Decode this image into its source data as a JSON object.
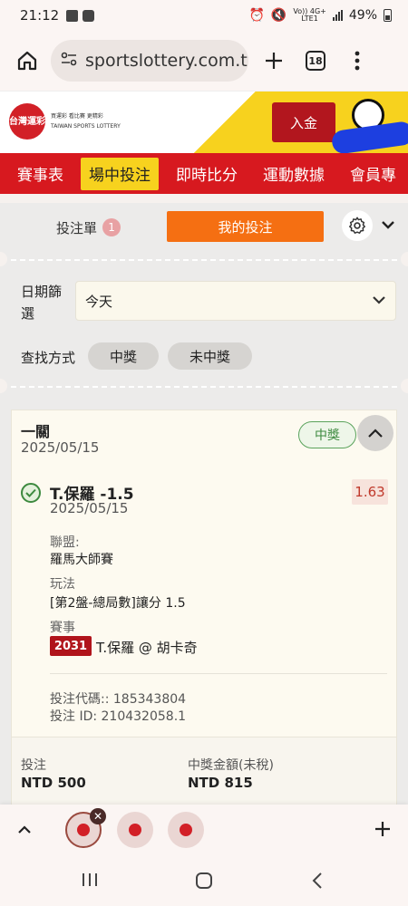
{
  "status_bar": {
    "time": "21:12",
    "network_top": "Vo)) 4G+",
    "network_bottom": "LTE1",
    "battery": "49%"
  },
  "browser": {
    "url": "sportslottery.com.tw",
    "tab_count": "18"
  },
  "site": {
    "logo_text": "台灣運彩",
    "logo_sub_line1": "買運彩  看比賽  更精彩",
    "logo_sub_line2": "TAIWAN SPORTS LOTTERY",
    "deposit_label": "入金"
  },
  "nav": {
    "items": [
      "賽事表",
      "場中投注",
      "即時比分",
      "運動數據",
      "會員專"
    ],
    "active_index": 1
  },
  "panel": {
    "betslip_label": "投注單",
    "betslip_count": "1",
    "mybets_label": "我的投注",
    "date_filter_label": "日期篩選",
    "date_filter_value": "今天",
    "search_label": "查找方式",
    "filter_win": "中獎",
    "filter_lose": "未中獎"
  },
  "bet": {
    "title": "一關",
    "date": "2025/05/15",
    "status": "中獎",
    "selection": "T.保羅 -1.5",
    "selection_date": "2025/05/15",
    "odds": "1.63",
    "league_label": "聯盟:",
    "league_value": "羅馬大師賽",
    "market_label": "玩法",
    "market_value": "[第2盤-總局數]讓分 1.5",
    "event_label": "賽事",
    "event_code": "2031",
    "event_name": "T.保羅 @ 胡卡奇",
    "bet_code": "投注代碼:: 185343804",
    "bet_id": "投注 ID: 210432058.1",
    "stake_label": "投注",
    "stake_value": "NTD 500",
    "payout_label": "中獎金額(未稅)",
    "payout_value": "NTD 815"
  },
  "dock": {
    "close_glyph": "✕"
  },
  "colors": {
    "brand_red": "#d7191f",
    "yellow": "#f7d21e",
    "orange": "#f56f12",
    "win_green": "#3d8a3f"
  }
}
